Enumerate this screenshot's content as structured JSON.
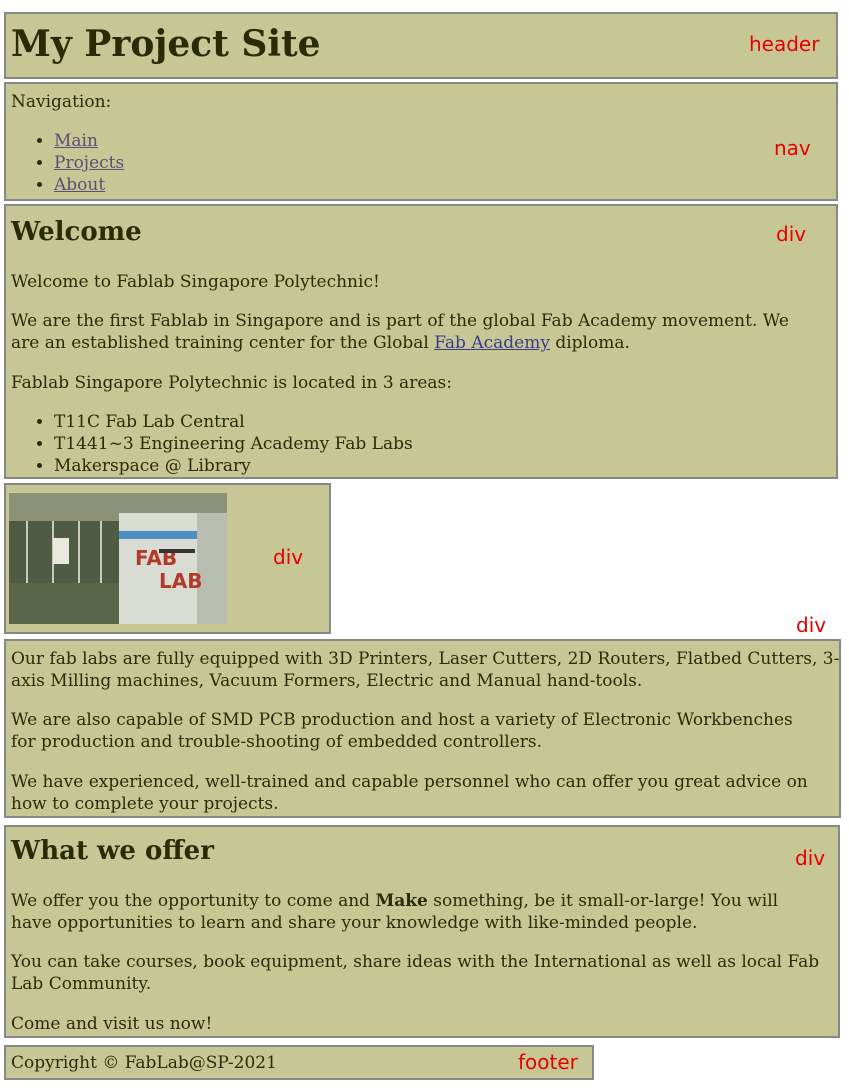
{
  "labels": {
    "header": "header",
    "nav": "nav",
    "div": "div",
    "footer": "footer"
  },
  "header": {
    "title": "My Project Site"
  },
  "nav": {
    "label": "Navigation:",
    "links": [
      "Main",
      "Projects",
      "About"
    ]
  },
  "welcome": {
    "heading": "Welcome",
    "p1": "Welcome to Fablab Singapore Polytechnic!",
    "p2_before": "We are the first Fablab in Singapore and is part of the global Fab Academy movement. We are an established training center for the Global ",
    "p2_link": "Fab Academy",
    "p2_after": " diploma.",
    "p3": "Fablab Singapore Polytechnic is located in 3 areas:",
    "areas": [
      "T11C Fab Lab Central",
      "T1441~3 Engineering Academy Fab Labs",
      "Makerspace @ Library"
    ]
  },
  "image": {
    "sign_line1": "FAB",
    "sign_line2": "LAB"
  },
  "equipment": {
    "p1": "Our fab labs are fully equipped with 3D Printers, Laser Cutters, 2D Routers, Flatbed Cutters, 3-axis Milling machines, Vacuum Formers, Electric and Manual hand-tools.",
    "p2": "We are also capable of SMD PCB production and host a variety of Electronic Workbenches for production and trouble-shooting of embedded controllers.",
    "p3": "We have experienced, well-trained and capable personnel who can offer you great advice on how to complete your projects."
  },
  "offer": {
    "heading": "What we offer",
    "p1_before": "We offer you the opportunity to come and ",
    "p1_bold": "Make",
    "p1_after": " something, be it small-or-large! You will have opportunities to learn and share your knowledge with like-minded people.",
    "p2": "You can take courses, book equipment, share ideas with the International as well as local Fab Lab Community.",
    "p3": "Come and visit us now!"
  },
  "footer": {
    "copyright": "Copyright © FabLab@SP-2021"
  },
  "colors": {
    "box_bg": "#c7c796",
    "border": "#888888",
    "tag": "#e60000",
    "text": "#2a2a05",
    "link": "#5c4d75"
  }
}
